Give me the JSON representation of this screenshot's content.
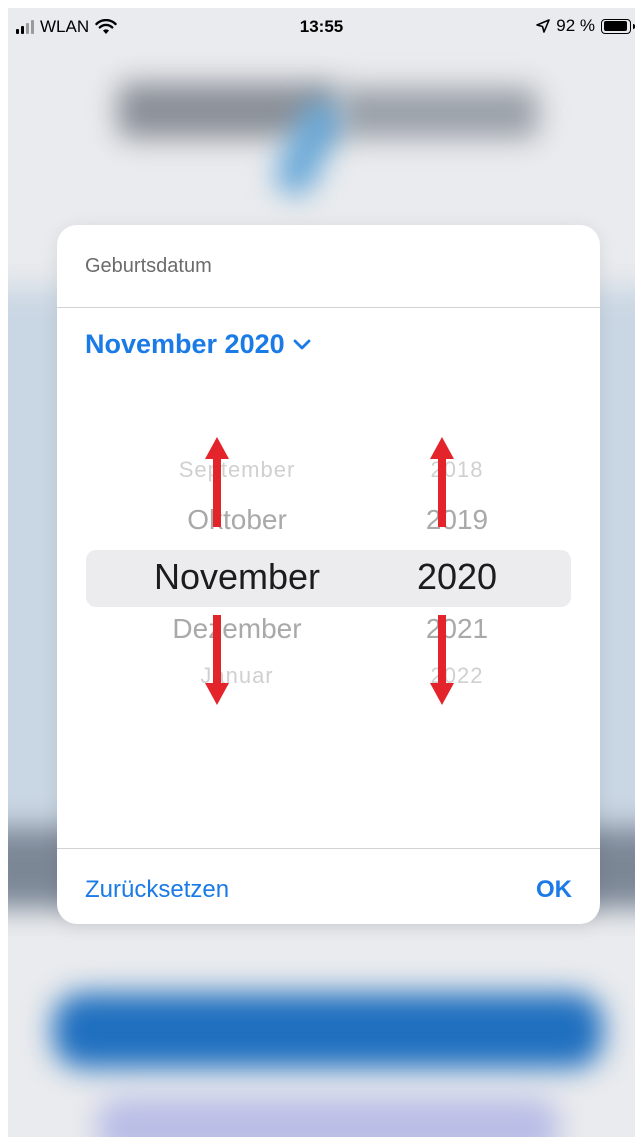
{
  "status_bar": {
    "carrier": "WLAN",
    "time": "13:55",
    "battery_text": "92 %",
    "battery_level": 0.92,
    "icons": [
      "signal-icon",
      "wifi-icon",
      "location-icon",
      "battery-icon"
    ]
  },
  "dialog": {
    "title": "Geburtsdatum",
    "header_label": "November 2020",
    "header_icon": "chevron-down-icon",
    "picker": {
      "months": [
        "September",
        "Oktober",
        "November",
        "Dezember",
        "Januar"
      ],
      "years": [
        "2018",
        "2019",
        "2020",
        "2021",
        "2022"
      ],
      "selected_month": "November",
      "selected_year": "2020"
    },
    "reset_label": "Zurücksetzen",
    "ok_label": "OK"
  },
  "annotations": {
    "arrow_color": "#e3242b",
    "arrows": [
      "month-up",
      "month-down",
      "year-up",
      "year-down"
    ]
  },
  "colors": {
    "accent": "#1a7ae6",
    "dialog_bg": "#ffffff",
    "highlight": "#ececee"
  }
}
